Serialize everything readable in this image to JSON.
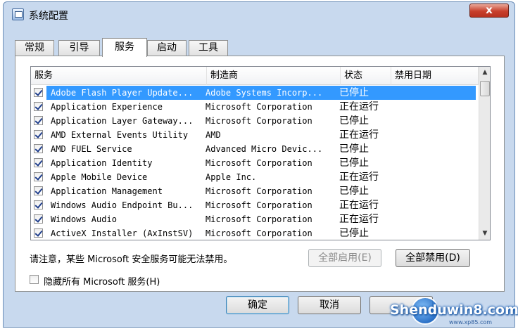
{
  "window": {
    "title": "系统配置",
    "close_symbol": "x",
    "icon": "msconfig-icon"
  },
  "tabs": [
    {
      "label": "常规",
      "active": false
    },
    {
      "label": "引导",
      "active": false
    },
    {
      "label": "服务",
      "active": true
    },
    {
      "label": "启动",
      "active": false
    },
    {
      "label": "工具",
      "active": false
    }
  ],
  "services_table": {
    "columns": [
      "服务",
      "制造商",
      "状态",
      "禁用日期"
    ],
    "rows": [
      {
        "checked": true,
        "name": "Adobe Flash Player Update...",
        "vendor": "Adobe Systems Incorp...",
        "status": "已停止",
        "disabled_date": "",
        "selected": true
      },
      {
        "checked": true,
        "name": "Application Experience",
        "vendor": "Microsoft Corporation",
        "status": "正在运行",
        "disabled_date": ""
      },
      {
        "checked": true,
        "name": "Application Layer Gateway...",
        "vendor": "Microsoft Corporation",
        "status": "已停止",
        "disabled_date": ""
      },
      {
        "checked": true,
        "name": "AMD External Events Utility",
        "vendor": "AMD",
        "status": "正在运行",
        "disabled_date": ""
      },
      {
        "checked": true,
        "name": "AMD FUEL Service",
        "vendor": "Advanced Micro Devic...",
        "status": "已停止",
        "disabled_date": ""
      },
      {
        "checked": true,
        "name": "Application Identity",
        "vendor": "Microsoft Corporation",
        "status": "已停止",
        "disabled_date": ""
      },
      {
        "checked": true,
        "name": "Apple Mobile Device",
        "vendor": "Apple Inc.",
        "status": "正在运行",
        "disabled_date": ""
      },
      {
        "checked": true,
        "name": "Application Management",
        "vendor": "Microsoft Corporation",
        "status": "已停止",
        "disabled_date": ""
      },
      {
        "checked": true,
        "name": "Windows Audio Endpoint Bu...",
        "vendor": "Microsoft Corporation",
        "status": "正在运行",
        "disabled_date": ""
      },
      {
        "checked": true,
        "name": "Windows Audio",
        "vendor": "Microsoft Corporation",
        "status": "正在运行",
        "disabled_date": ""
      },
      {
        "checked": true,
        "name": "ActiveX Installer (AxInstSV)",
        "vendor": "Microsoft Corporation",
        "status": "已停止",
        "disabled_date": ""
      }
    ]
  },
  "scrollbar": {
    "up_symbol": "▲",
    "down_symbol": "▼"
  },
  "notice": "请注意，某些 Microsoft 安全服务可能无法禁用。",
  "buttons": {
    "enable_all": "全部启用(E)",
    "disable_all": "全部禁用(D)",
    "ok": "确定",
    "cancel": "取消"
  },
  "hide_ms": {
    "checked": false,
    "label": "隐藏所有 Microsoft 服务(H)"
  },
  "watermark": {
    "text": "Shenduwin8.com",
    "sub": "www.xp85.com"
  }
}
